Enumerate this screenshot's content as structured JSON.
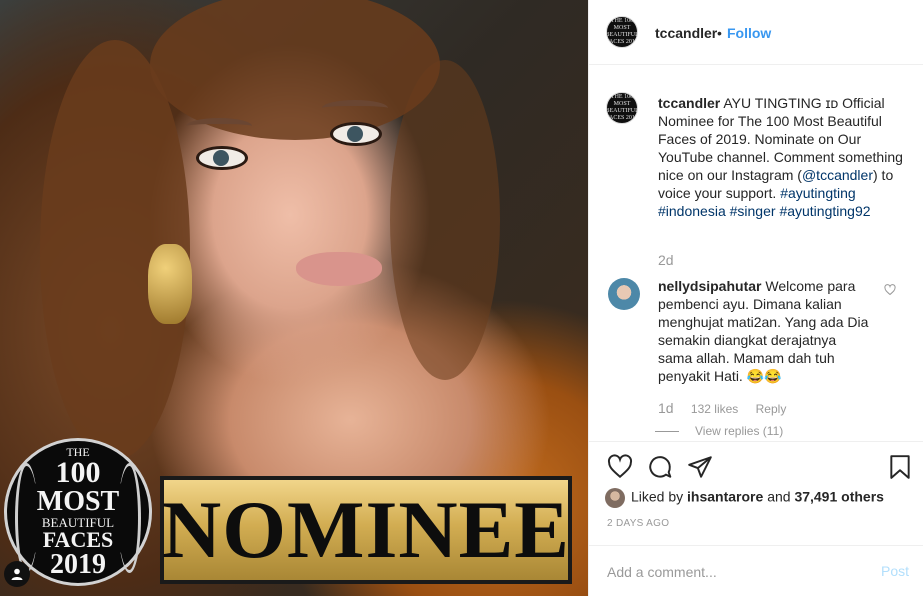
{
  "photo": {
    "badge": {
      "line1": "THE",
      "line2": "100",
      "line3": "MOST",
      "line4": "BEAUTIFUL",
      "line5": "FACES",
      "line6": "2019"
    },
    "banner_text": "NOMINEE"
  },
  "header": {
    "username": "tccandler",
    "separator": "•",
    "follow_label": "Follow",
    "avatar_text": "THE 100 MOST BEAUTIFUL FACES 2019"
  },
  "caption": {
    "username": "tccandler",
    "text_part1": "AYU TINGTING ɪᴅ Official Nominee for The 100 Most Beautiful Faces of 2019. Nominate on Our YouTube channel. Comment something nice on our Instagram (",
    "mention": "@tccandler",
    "text_part2": ") to voice your support.",
    "hashtag1": "#ayutingting",
    "hashtag2": "#indonesia",
    "hashtag3": "#singer",
    "hashtag4": "#ayutingting92",
    "time": "2d"
  },
  "comment": {
    "username": "nellydsipahutar",
    "text": "Welcome para pembenci ayu. Dimana kalian menghujat mati2an. Yang ada Dia semakin diangkat derajatnya sama allah. Mamam dah tuh penyakit Hati. 😂😂",
    "time": "1d",
    "likes": "132 likes",
    "reply_label": "Reply",
    "view_replies": "View replies (11)"
  },
  "actions": {
    "like_icon": "heart-icon",
    "comment_icon": "comment-icon",
    "share_icon": "share-icon",
    "save_icon": "bookmark-icon"
  },
  "likes": {
    "prefix": "Liked by",
    "user": "ihsantarore",
    "conj": "and",
    "others": "37,491 others"
  },
  "post_date": "2 DAYS AGO",
  "comment_box": {
    "placeholder": "Add a comment...",
    "post_label": "Post"
  },
  "colors": {
    "link": "#003569",
    "follow": "#3897f0",
    "muted": "#999999",
    "post_disabled": "#b2dffc"
  }
}
